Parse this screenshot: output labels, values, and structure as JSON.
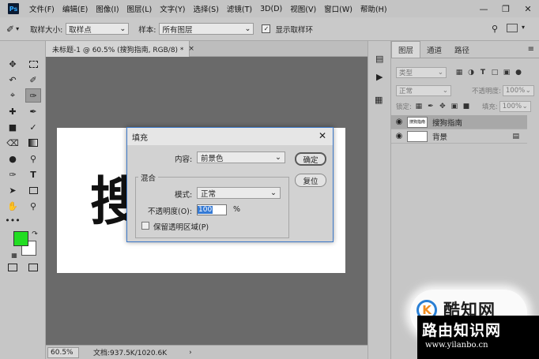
{
  "app": {
    "logo": "Ps"
  },
  "menubar": {
    "items": [
      "文件(F)",
      "编辑(E)",
      "图像(I)",
      "图层(L)",
      "文字(Y)",
      "选择(S)",
      "滤镜(T)",
      "3D(D)",
      "视图(V)",
      "窗口(W)",
      "帮助(H)"
    ],
    "window_controls": [
      "minimize-icon",
      "restore-icon",
      "close-icon"
    ]
  },
  "options": {
    "sample_size_label": "取样大小:",
    "sample_size_value": "取样点",
    "sample_label": "样本:",
    "sample_value": "所有图层",
    "show_ring_label": "显示取样环",
    "show_ring_checked": true
  },
  "document": {
    "tab_title": "未标题-1 @ 60.5% (搜狗指南, RGB/8) *",
    "canvas_text": "搜"
  },
  "status": {
    "zoom": "60.5%",
    "doc_info": "文档:937.5K/1020.6K"
  },
  "colors": {
    "foreground": "#22dd22",
    "background": "#ffffff",
    "accent": "#3479d4"
  },
  "layers_panel": {
    "tabs": [
      "图层",
      "通道",
      "路径"
    ],
    "filter_placeholder": "类型",
    "blend_mode": "正常",
    "opacity_label": "不透明度:",
    "opacity_value": "100%",
    "lock_label": "锁定:",
    "fill_label": "填充:",
    "fill_value": "100%",
    "layers": [
      {
        "name": "搜狗指南",
        "selected": true,
        "visible": true
      },
      {
        "name": "背景",
        "selected": false,
        "visible": true,
        "locked": true
      }
    ]
  },
  "fill_dialog": {
    "title": "填充",
    "contents_label": "内容:",
    "contents_value": "前景色",
    "ok_label": "确定",
    "cancel_label": "复位",
    "blending_title": "混合",
    "mode_label": "模式:",
    "mode_value": "正常",
    "opacity_label": "不透明度(O):",
    "opacity_value": "100",
    "opacity_unit": "%",
    "preserve_label": "保留透明区域(P)",
    "preserve_checked": false
  },
  "watermark": {
    "brand": "酷知网",
    "site_name": "路由知识网",
    "url": "www.yilanbo.cn"
  }
}
